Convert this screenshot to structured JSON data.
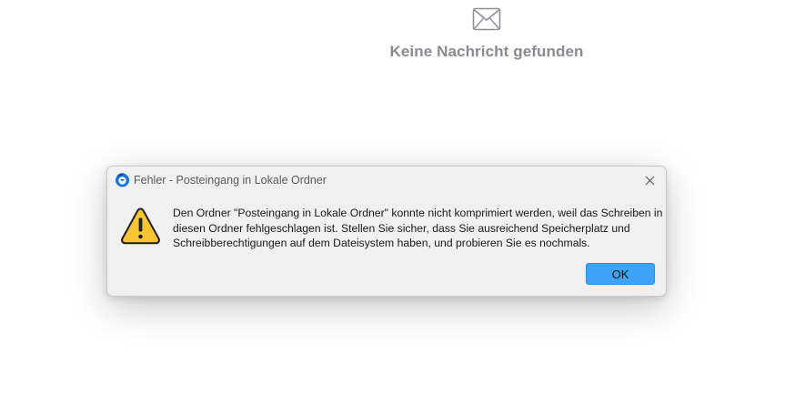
{
  "empty_state": {
    "icon": "envelope-icon",
    "text": "Keine Nachricht gefunden"
  },
  "dialog": {
    "app_icon": "thunderbird-icon",
    "title": "Fehler - Posteingang in Lokale Ordner",
    "close_icon": "close-icon",
    "warning_icon": "warning-icon",
    "message": "Den Ordner \"Posteingang in Lokale Ordner\" konnte nicht komprimiert werden, weil das Schreiben in diesen Ordner fehlgeschlagen ist. Stellen Sie sicher, dass Sie ausreichend Speicherplatz und Schreibberechtigungen auf dem Dateisystem haben, und probieren Sie es nochmals.",
    "ok_label": "OK"
  },
  "colors": {
    "ok_button": "#3ea3f6",
    "warning_fill": "#f7c531",
    "dialog_bg": "#f0f0f0",
    "empty_text": "#8a8a90"
  }
}
